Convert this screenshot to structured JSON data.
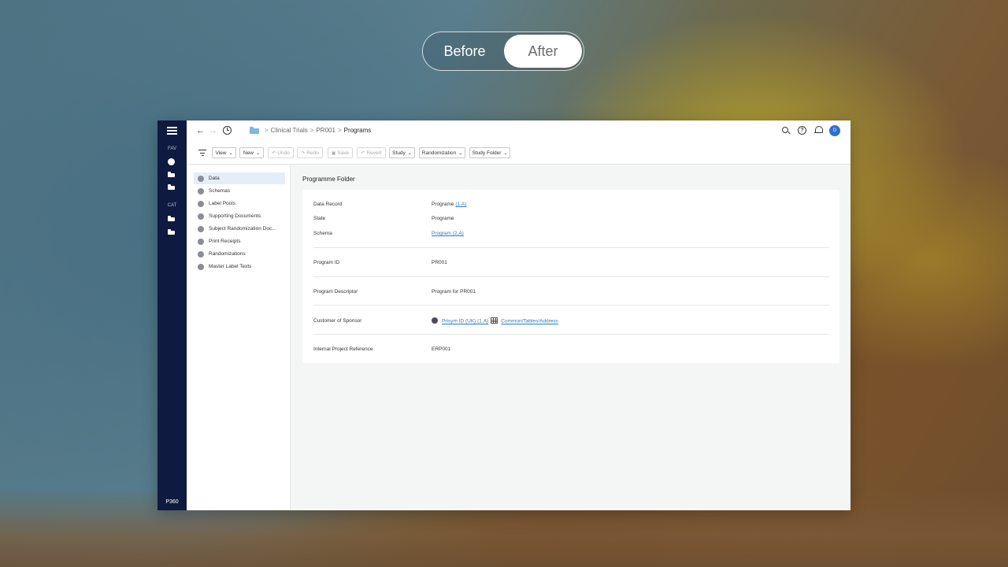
{
  "toggle": {
    "before_label": "Before",
    "after_label": "After",
    "selected": "After"
  },
  "rail": {
    "fav_label": "FAV",
    "cat_label": "CAT",
    "brand": "P360"
  },
  "breadcrumb": {
    "items": [
      "Clinical Trials",
      "PR001"
    ],
    "current": "Programs"
  },
  "avatar_initial": "D",
  "toolbar": {
    "view": "View",
    "new": "New",
    "undo": "Undo",
    "redo": "Redo",
    "save": "Save",
    "revert": "Revert",
    "study": "Study",
    "randomization": "Randomization",
    "study_folder": "Study Folder"
  },
  "list": [
    "Data",
    "Schemas",
    "Label Pools",
    "Supporting Documents",
    "Subject Randomization Doc...",
    "Print Receipts",
    "Randomizations",
    "Master Label Texts"
  ],
  "main": {
    "title": "Programme Folder",
    "data_record": {
      "label": "Data Record",
      "value": "Programe",
      "link": "(1.A)"
    },
    "state": {
      "label": "State",
      "value": "Programe"
    },
    "schema": {
      "label": "Schema",
      "link": "Program (2.A)"
    },
    "program_id": {
      "label": "Program ID",
      "value": "PR001"
    },
    "program_descriptor": {
      "label": "Program Descriptor",
      "value": "Program for PR001"
    },
    "customer": {
      "label": "Customer of Sponsor",
      "sponsor_link": "Prisym ID (UK) (1.A)",
      "address_link": "Common/Tables/Address"
    },
    "internal_ref": {
      "label": "Internal Project Reference",
      "value": "ERP001"
    }
  },
  "colors": {
    "rail": "#0e1a3f",
    "accent": "#2f6fcf",
    "link": "#2b7bc4",
    "active_item": "#e4eef8"
  }
}
